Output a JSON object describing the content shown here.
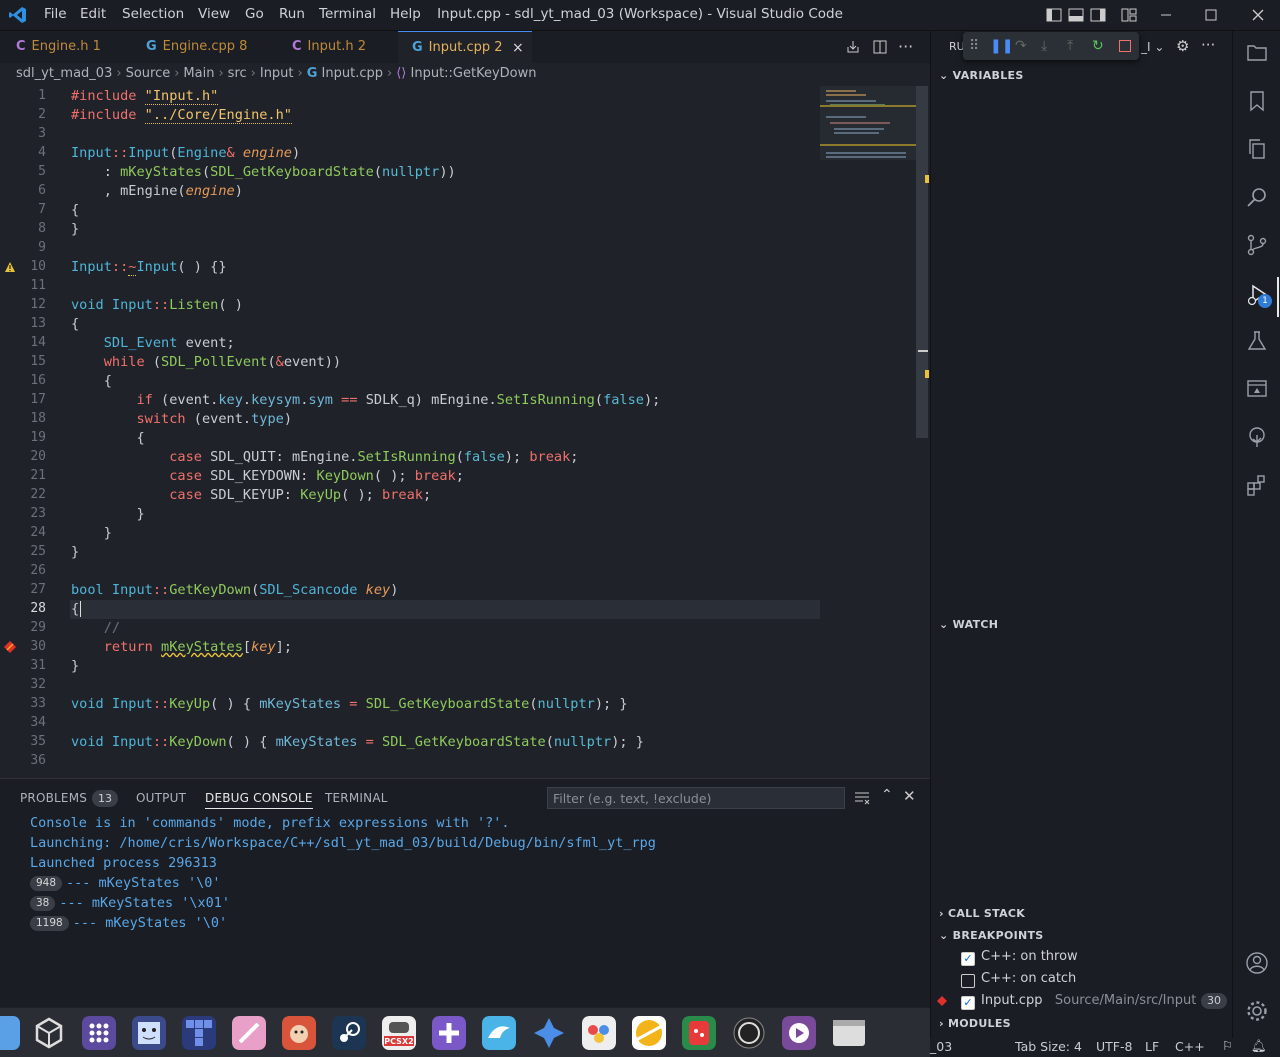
{
  "window": {
    "title": "Input.cpp - sdl_yt_mad_03 (Workspace) - Visual Studio Code"
  },
  "menu": [
    "File",
    "Edit",
    "Selection",
    "View",
    "Go",
    "Run",
    "Terminal",
    "Help"
  ],
  "tabs": [
    {
      "icon": "C",
      "name": "Engine.h",
      "count": "1"
    },
    {
      "icon": "C",
      "name": "Engine.cpp",
      "count": "8"
    },
    {
      "icon": "C",
      "name": "Input.h",
      "count": "2"
    },
    {
      "icon": "C",
      "name": "Input.cpp",
      "count": "2"
    }
  ],
  "breadcrumb": [
    "sdl_yt_mad_03",
    "Source",
    "Main",
    "src",
    "Input",
    "Input.cpp",
    "Input::GetKeyDown"
  ],
  "line_numbers": [
    "1",
    "2",
    "3",
    "4",
    "5",
    "6",
    "7",
    "8",
    "9",
    "10",
    "11",
    "12",
    "13",
    "14",
    "15",
    "16",
    "17",
    "18",
    "19",
    "20",
    "21",
    "22",
    "23",
    "24",
    "25",
    "26",
    "27",
    "28",
    "29",
    "30",
    "31",
    "32",
    "33",
    "34",
    "35",
    "36"
  ],
  "code": {
    "l1a": "#include ",
    "l1b": "\"Input.h\"",
    "l2a": "#include ",
    "l2b": "\"../Core/Engine.h\"",
    "l4a": "Input",
    "l4b": "::",
    "l4c": "Input",
    "l4d": "(",
    "l4e": "Engine",
    "l4f": "&",
    "l4g": " engine",
    "l4h": ")",
    "l5a": "    : ",
    "l5b": "mKeyStates",
    "l5c": "(",
    "l5d": "SDL_GetKeyboardState",
    "l5e": "(",
    "l5f": "nullptr",
    "l5g": "))",
    "l6a": "    , mEngine(",
    "l6b": "engine",
    "l6c": ")",
    "l7": "{",
    "l8": "}",
    "l10a": "Input",
    "l10b": "::",
    "l10c": "~",
    "l10d": "Input",
    "l10e": "( ) {}",
    "l12a": "void ",
    "l12b": "Input",
    "l12c": "::",
    "l12d": "Listen",
    "l12e": "( )",
    "l13": "{",
    "l14a": "    ",
    "l14b": "SDL_Event",
    "l14c": " event;",
    "l15a": "    ",
    "l15b": "while",
    "l15c": " (",
    "l15d": "SDL_PollEvent",
    "l15e": "(",
    "l15f": "&",
    "l15g": "event))",
    "l16": "    {",
    "l17a": "        ",
    "l17b": "if",
    "l17c": " (event.",
    "l17d": "key",
    "l17e": ".",
    "l17f": "keysym",
    "l17g": ".",
    "l17h": "sym",
    "l17i": " == ",
    "l17j": "SDLK_q) mEngine.",
    "l17k": "SetIsRunning",
    "l17l": "(",
    "l17m": "false",
    "l17n": ");",
    "l18a": "        ",
    "l18b": "switch",
    "l18c": " (event.",
    "l18d": "type",
    "l18e": ")",
    "l19": "        {",
    "l20a": "            ",
    "l20b": "case",
    "l20c": " SDL_QUIT: mEngine.",
    "l20d": "SetIsRunning",
    "l20e": "(",
    "l20f": "false",
    "l20g": "); ",
    "l20h": "break",
    "l20i": ";",
    "l21a": "            ",
    "l21b": "case",
    "l21c": " SDL_KEYDOWN: ",
    "l21d": "KeyDown",
    "l21e": "( ); ",
    "l21f": "break",
    "l21g": ";",
    "l22a": "            ",
    "l22b": "case",
    "l22c": " SDL_KEYUP: ",
    "l22d": "KeyUp",
    "l22e": "( ); ",
    "l22f": "break",
    "l22g": ";",
    "l23": "        }",
    "l24": "    }",
    "l25": "}",
    "l27a": "bool ",
    "l27b": "Input",
    "l27c": "::",
    "l27d": "GetKeyDown",
    "l27e": "(",
    "l27f": "SDL_Scancode",
    "l27g": " key",
    "l27h": ")",
    "l28": "{",
    "l29": "    //",
    "l30a": "    ",
    "l30b": "return",
    "l30c": " ",
    "l30d": "mKeyStates",
    "l30e": "[",
    "l30f": "key",
    "l30g": "];",
    "l31": "}",
    "l33a": "void ",
    "l33b": "Input",
    "l33c": "::",
    "l33d": "KeyUp",
    "l33e": "( ) { ",
    "l33f": "mKeyStates",
    "l33g": " = ",
    "l33h": "SDL_GetKeyboardState",
    "l33i": "(",
    "l33j": "nullptr",
    "l33k": "); }",
    "l35a": "void ",
    "l35b": "Input",
    "l35c": "::",
    "l35d": "KeyDown",
    "l35e": "( ) { ",
    "l35f": "mKeyStates",
    "l35g": " = ",
    "l35h": "SDL_GetKeyboardState",
    "l35i": "(",
    "l35j": "nullptr",
    "l35k": "); }"
  },
  "panel": {
    "tabs": [
      "PROBLEMS",
      "OUTPUT",
      "DEBUG CONSOLE",
      "TERMINAL"
    ],
    "problems_count": "13",
    "filter_placeholder": "Filter (e.g. text, !exclude)",
    "console": [
      "Console is in 'commands' mode, prefix expressions with '?'.",
      "Launching: /home/cris/Workspace/C++/sdl_yt_mad_03/build/Debug/bin/sfml_yt_rpg",
      "Launched process 296313"
    ],
    "repeated": [
      {
        "count": "948",
        "text": "--- mKeyStates '\\0'"
      },
      {
        "count": "38",
        "text": "--- mKeyStates '\\x01'"
      },
      {
        "count": "1198",
        "text": "--- mKeyStates '\\0'"
      }
    ]
  },
  "debug_sidebar": {
    "run_label": "RU",
    "variables": "VARIABLES",
    "watch": "WATCH",
    "call_stack": "CALL STACK",
    "breakpoints": "BREAKPOINTS",
    "bp_items": [
      {
        "label": "C++: on throw",
        "checked": true
      },
      {
        "label": "C++: on catch",
        "checked": false
      },
      {
        "label": "Input.cpp",
        "path": "Source/Main/src/Input",
        "line": "30",
        "checked": true
      }
    ],
    "modules": "MODULES",
    "activity_badge": "1"
  },
  "status": {
    "partial": "_03",
    "tab_size": "Tab Size: 4",
    "encoding": "UTF-8",
    "eol": "LF",
    "lang": "C++"
  },
  "colors": {
    "accent": "#4a8cf5",
    "warning": "#e8c33a",
    "breakpoint": "#e0302a"
  }
}
